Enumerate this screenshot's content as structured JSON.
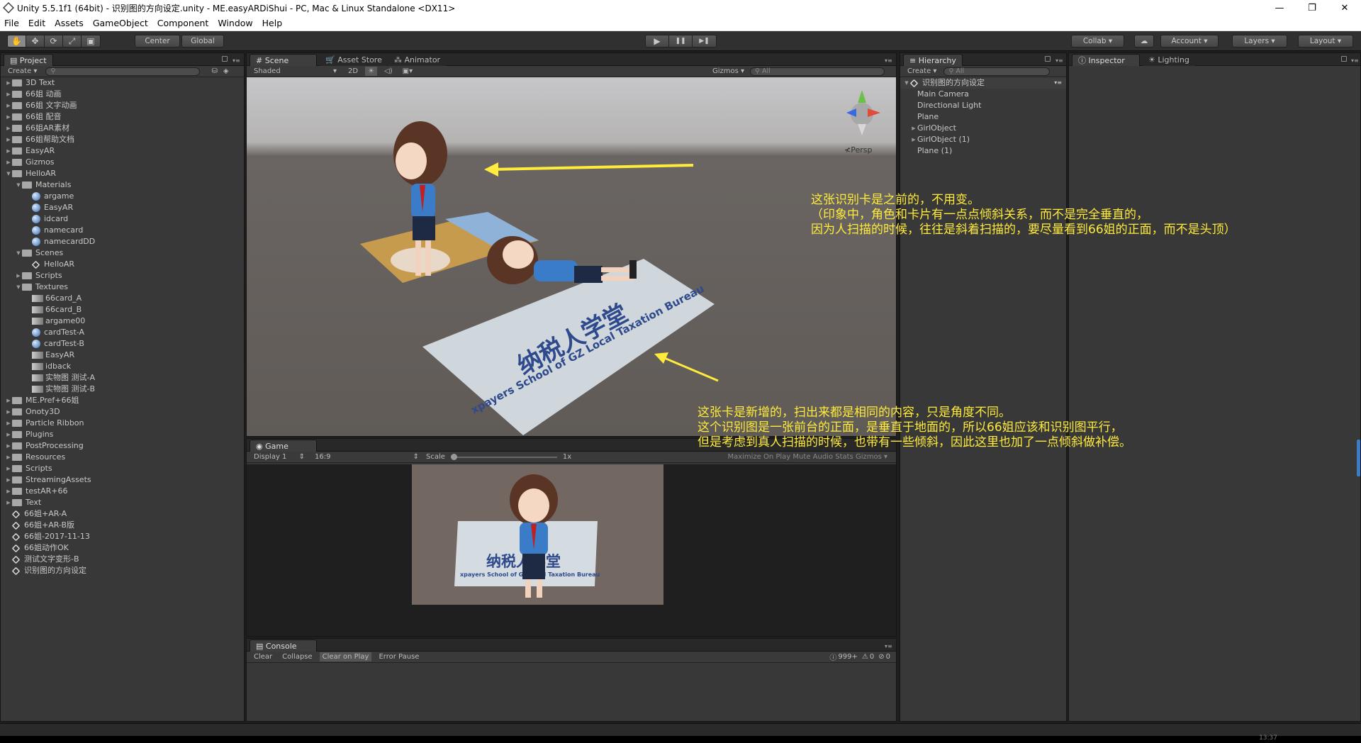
{
  "window": {
    "title": "Unity 5.5.1f1 (64bit) - 识别图的方向设定.unity - ME.easyARDiShui - PC, Mac & Linux Standalone <DX11>",
    "controls": [
      "—",
      "❐",
      "✕"
    ]
  },
  "menu": [
    "File",
    "Edit",
    "Assets",
    "GameObject",
    "Component",
    "Window",
    "Help"
  ],
  "toolbar": {
    "tools": [
      "✋",
      "✥",
      "⟳",
      "⤢",
      "▣"
    ],
    "pivot": "Center",
    "space": "Global",
    "play": [
      "▶",
      "❚❚",
      "▶❚"
    ],
    "collab": "Collab ▾",
    "cloud": "☁",
    "account": "Account",
    "layers": "Layers",
    "layout": "Layout"
  },
  "project": {
    "tab": "Project",
    "create": "Create ▾",
    "tree": [
      {
        "label": "3D Text",
        "depth": 0,
        "kind": "folder",
        "arrow": "▶"
      },
      {
        "label": "66姐 动画",
        "depth": 0,
        "kind": "folder",
        "arrow": "▶"
      },
      {
        "label": "66姐 文字动画",
        "depth": 0,
        "kind": "folder",
        "arrow": "▶"
      },
      {
        "label": "66姐 配音",
        "depth": 0,
        "kind": "folder",
        "arrow": "▶"
      },
      {
        "label": "66姐AR素材",
        "depth": 0,
        "kind": "folder",
        "arrow": "▶"
      },
      {
        "label": "66姐帮助文档",
        "depth": 0,
        "kind": "folder",
        "arrow": "▶"
      },
      {
        "label": "EasyAR",
        "depth": 0,
        "kind": "folder",
        "arrow": "▶"
      },
      {
        "label": "Gizmos",
        "depth": 0,
        "kind": "folder",
        "arrow": "▶"
      },
      {
        "label": "HelloAR",
        "depth": 0,
        "kind": "folder",
        "arrow": "▼"
      },
      {
        "label": "Materials",
        "depth": 1,
        "kind": "folder",
        "arrow": "▼"
      },
      {
        "label": "argame",
        "depth": 2,
        "kind": "material",
        "arrow": ""
      },
      {
        "label": "EasyAR",
        "depth": 2,
        "kind": "material",
        "arrow": ""
      },
      {
        "label": "idcard",
        "depth": 2,
        "kind": "material",
        "arrow": ""
      },
      {
        "label": "namecard",
        "depth": 2,
        "kind": "material",
        "arrow": ""
      },
      {
        "label": "namecardDD",
        "depth": 2,
        "kind": "material",
        "arrow": ""
      },
      {
        "label": "Scenes",
        "depth": 1,
        "kind": "folder",
        "arrow": "▼"
      },
      {
        "label": "HelloAR",
        "depth": 2,
        "kind": "scene",
        "arrow": ""
      },
      {
        "label": "Scripts",
        "depth": 1,
        "kind": "folder",
        "arrow": "▶"
      },
      {
        "label": "Textures",
        "depth": 1,
        "kind": "folder",
        "arrow": "▼"
      },
      {
        "label": "66card_A",
        "depth": 2,
        "kind": "texture",
        "arrow": ""
      },
      {
        "label": "66card_B",
        "depth": 2,
        "kind": "texture",
        "arrow": ""
      },
      {
        "label": "argame00",
        "depth": 2,
        "kind": "texture",
        "arrow": ""
      },
      {
        "label": "cardTest-A",
        "depth": 2,
        "kind": "material",
        "arrow": ""
      },
      {
        "label": "cardTest-B",
        "depth": 2,
        "kind": "material",
        "arrow": ""
      },
      {
        "label": "EasyAR",
        "depth": 2,
        "kind": "texture",
        "arrow": ""
      },
      {
        "label": "idback",
        "depth": 2,
        "kind": "texture",
        "arrow": ""
      },
      {
        "label": "实物图 测试-A",
        "depth": 2,
        "kind": "texture",
        "arrow": ""
      },
      {
        "label": "实物图 测试-B",
        "depth": 2,
        "kind": "texture",
        "arrow": ""
      },
      {
        "label": "ME.Pref+66姐",
        "depth": 0,
        "kind": "folder",
        "arrow": "▶"
      },
      {
        "label": "Onoty3D",
        "depth": 0,
        "kind": "folder",
        "arrow": "▶"
      },
      {
        "label": "Particle Ribbon",
        "depth": 0,
        "kind": "folder",
        "arrow": "▶"
      },
      {
        "label": "Plugins",
        "depth": 0,
        "kind": "folder",
        "arrow": "▶"
      },
      {
        "label": "PostProcessing",
        "depth": 0,
        "kind": "folder",
        "arrow": "▶"
      },
      {
        "label": "Resources",
        "depth": 0,
        "kind": "folder",
        "arrow": "▶"
      },
      {
        "label": "Scripts",
        "depth": 0,
        "kind": "folder",
        "arrow": "▶"
      },
      {
        "label": "StreamingAssets",
        "depth": 0,
        "kind": "folder",
        "arrow": "▶"
      },
      {
        "label": "testAR+66",
        "depth": 0,
        "kind": "folder",
        "arrow": "▶"
      },
      {
        "label": "Text",
        "depth": 0,
        "kind": "folder",
        "arrow": "▶"
      },
      {
        "label": "66姐+AR-A",
        "depth": 0,
        "kind": "scene",
        "arrow": ""
      },
      {
        "label": "66姐+AR-B版",
        "depth": 0,
        "kind": "scene",
        "arrow": ""
      },
      {
        "label": "66姐-2017-11-13",
        "depth": 0,
        "kind": "scene",
        "arrow": ""
      },
      {
        "label": "66姐动作OK",
        "depth": 0,
        "kind": "scene",
        "arrow": ""
      },
      {
        "label": "测试文字变形-B",
        "depth": 0,
        "kind": "scene",
        "arrow": ""
      },
      {
        "label": "识别图的方向设定",
        "depth": 0,
        "kind": "scene",
        "arrow": ""
      }
    ]
  },
  "scene": {
    "tabs": [
      "Scene",
      "Asset Store",
      "Animator"
    ],
    "shading": "Shaded",
    "mode2d": "2D",
    "gizmos": "Gizmos ▾",
    "search": "All",
    "persp": "≮Persp",
    "card_text": "纳税人学堂",
    "card_subtext": "xpayers School of GZ Local Taxation Bureau"
  },
  "game": {
    "tab": "Game",
    "display": "Display 1",
    "aspect": "16:9",
    "scale_label": "Scale",
    "scale_value": "1x",
    "right_opts": "Maximize On Play   Mute Audio   Stats   Gizmos ▾",
    "card_text": "纳税人学堂",
    "card_subtext": "xpayers School of GZ Local Taxation Bureau"
  },
  "console": {
    "tab": "Console",
    "buttons": [
      "Clear",
      "Collapse",
      "Clear on Play",
      "Error Pause"
    ],
    "counts": {
      "logs": "999+",
      "warnings": "0",
      "errors": "0"
    }
  },
  "hierarchy": {
    "tab": "Hierarchy",
    "create": "Create ▾",
    "search": "All",
    "scene": "识别图的方向设定",
    "items": [
      {
        "label": "Main Camera",
        "arrow": ""
      },
      {
        "label": "Directional Light",
        "arrow": ""
      },
      {
        "label": "Plane",
        "arrow": ""
      },
      {
        "label": "GirlObject",
        "arrow": "▶"
      },
      {
        "label": "GirlObject (1)",
        "arrow": "▶"
      },
      {
        "label": "Plane (1)",
        "arrow": ""
      }
    ]
  },
  "inspector": {
    "tabs": [
      "Inspector",
      "Lighting"
    ]
  },
  "annotations": {
    "top": [
      "这张识别卡是之前的，不用变。",
      "（印象中，角色和卡片有一点点倾斜关系，而不是完全垂直的，",
      "因为人扫描的时候，往往是斜着扫描的，要尽量看到66姐的正面，而不是头顶）"
    ],
    "bottom": [
      "这张卡是新增的，扫出来都是相同的内容，只是角度不同。",
      "这个识别图是一张前台的正面，是垂直于地面的，所以66姐应该和识别图平行，",
      "但是考虑到真人扫描的时候，也带有一些倾斜，因此这里也加了一点倾斜做补偿。"
    ],
    "color": "#ffeb3b"
  },
  "statusbar": {
    "clock": "13:37"
  }
}
